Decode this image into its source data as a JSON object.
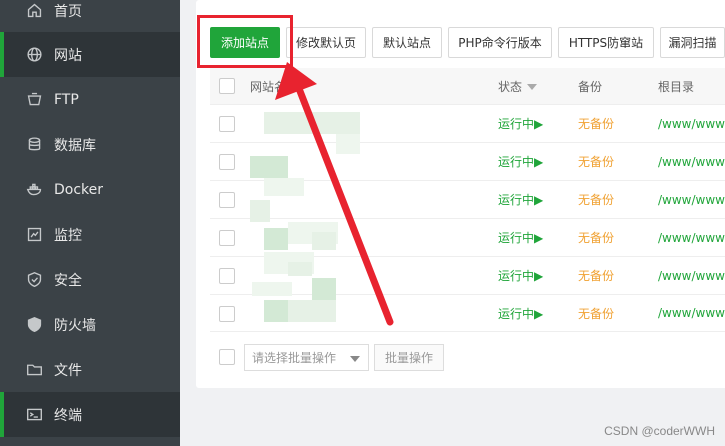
{
  "sidebar": {
    "items": [
      {
        "label": "首页",
        "icon": "home-icon"
      },
      {
        "label": "网站",
        "icon": "globe-icon",
        "active": true
      },
      {
        "label": "FTP",
        "icon": "ftp-icon"
      },
      {
        "label": "数据库",
        "icon": "database-icon"
      },
      {
        "label": "Docker",
        "icon": "docker-icon"
      },
      {
        "label": "监控",
        "icon": "monitor-icon"
      },
      {
        "label": "安全",
        "icon": "shield-check-icon"
      },
      {
        "label": "防火墙",
        "icon": "firewall-shield-icon"
      },
      {
        "label": "文件",
        "icon": "folder-icon"
      },
      {
        "label": "终端",
        "icon": "terminal-icon",
        "active": true
      }
    ]
  },
  "toolbar": {
    "add_site": "添加站点",
    "edit_default_page": "修改默认页",
    "default_site": "默认站点",
    "php_cli_version": "PHP命令行版本",
    "https_anti": "HTTPS防窜站",
    "vuln_scan": "漏洞扫描"
  },
  "table": {
    "headers": {
      "site_name": "网站名",
      "status": "状态",
      "backup": "备份",
      "root": "根目录"
    },
    "rows": [
      {
        "status": "运行中▶",
        "backup": "无备份",
        "root": "/www/wwwr"
      },
      {
        "status": "运行中▶",
        "backup": "无备份",
        "root": "/www/wwwr"
      },
      {
        "status": "运行中▶",
        "backup": "无备份",
        "root": "/www/wwwr"
      },
      {
        "status": "运行中▶",
        "backup": "无备份",
        "root": "/www/wwwr"
      },
      {
        "status": "运行中▶",
        "backup": "无备份",
        "root": "/www/wwwr"
      },
      {
        "status": "运行中▶",
        "backup": "无备份",
        "root": "/www/wwwr"
      }
    ]
  },
  "footer": {
    "batch_placeholder": "请选择批量操作",
    "batch_button": "批量操作"
  },
  "watermark": "CSDN @coderWWH",
  "colors": {
    "accent": "#20a53a",
    "sidebar": "#3b4247",
    "highlight": "#e8232f",
    "backup": "#f0a132"
  }
}
